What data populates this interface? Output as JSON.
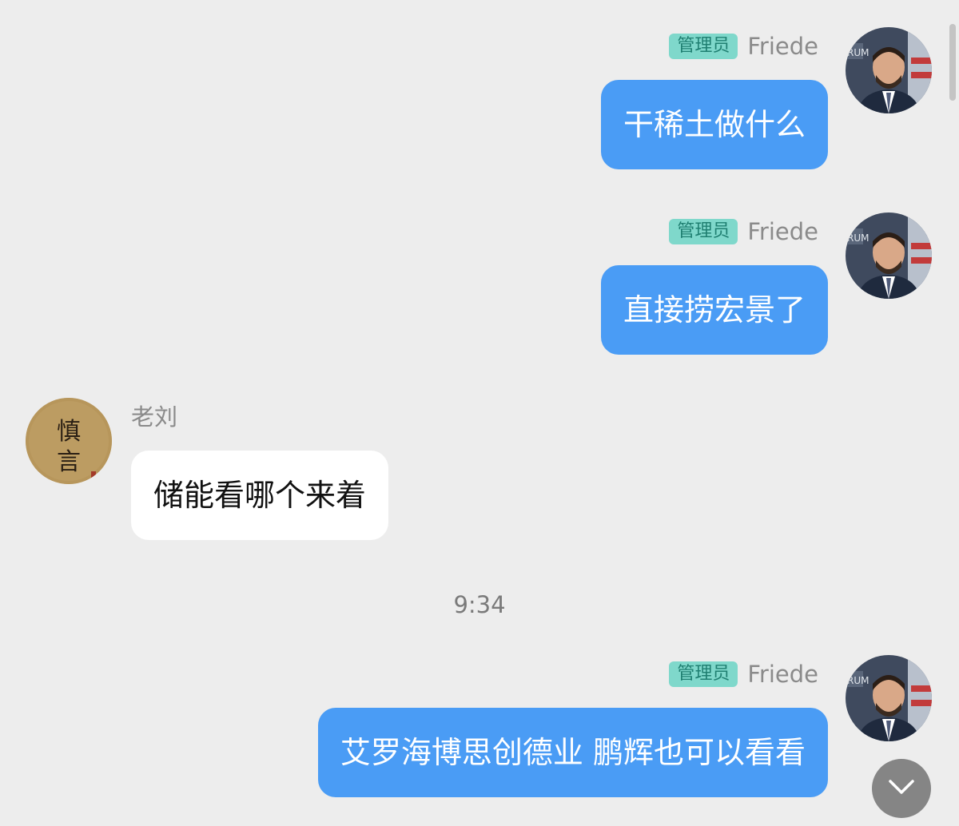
{
  "messages": [
    {
      "side": "right",
      "role_badge": "管理员",
      "sender": "Friede",
      "text": "干稀土做什么",
      "avatar": "portrait-avatar"
    },
    {
      "side": "right",
      "role_badge": "管理员",
      "sender": "Friede",
      "text": "直接捞宏景了",
      "avatar": "portrait-avatar"
    },
    {
      "side": "left",
      "role_badge": "",
      "sender": "老刘",
      "text": "储能看哪个来着",
      "avatar": "calligraphy-avatar",
      "avatar_text": "慎言"
    },
    {
      "side": "right",
      "role_badge": "管理员",
      "sender": "Friede",
      "text": "艾罗海博思创德业 鹏辉也可以看看",
      "avatar": "portrait-avatar"
    }
  ],
  "timestamp": "9:34",
  "icons": {
    "scroll_down": "chevron-down-icon"
  },
  "colors": {
    "background": "#ededed",
    "outgoing_bubble": "#4a9cf5",
    "incoming_bubble": "#ffffff",
    "badge_bg": "#7fd8cb",
    "badge_text": "#1f7f71"
  }
}
